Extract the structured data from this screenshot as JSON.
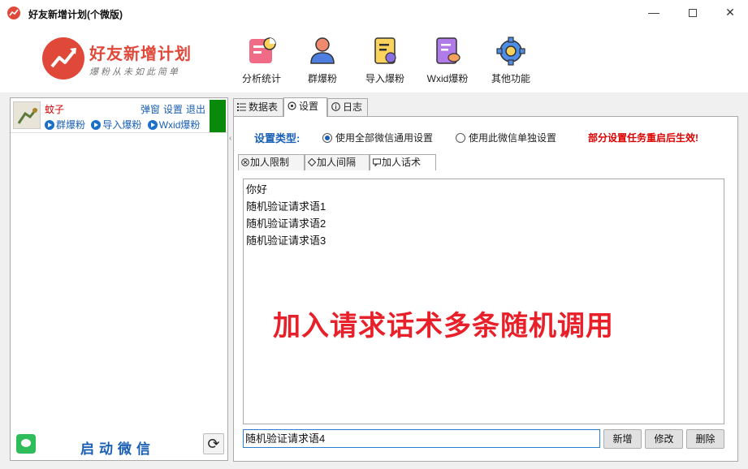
{
  "window": {
    "title": "好友新增计划(个微版)",
    "min": "—",
    "close": "✕"
  },
  "header": {
    "logo_title": "好友新增计划",
    "logo_slogan": "爆粉从未如此简单",
    "tools": [
      {
        "label": "分析统计",
        "icon": "chart-doc-icon"
      },
      {
        "label": "群爆粉",
        "icon": "user-icon"
      },
      {
        "label": "导入爆粉",
        "icon": "import-doc-icon"
      },
      {
        "label": "Wxid爆粉",
        "icon": "chat-doc-icon"
      },
      {
        "label": "其他功能",
        "icon": "gear-icon"
      }
    ]
  },
  "account": {
    "name": "蚊子",
    "actions": [
      "弹窗",
      "设置",
      "退出"
    ],
    "links": [
      "群爆粉",
      "导入爆粉",
      "Wxid爆粉"
    ]
  },
  "left_footer": {
    "start_label": "启动微信"
  },
  "main_tabs": [
    {
      "label": "数据表",
      "active": false
    },
    {
      "label": "设置",
      "active": true
    },
    {
      "label": "日志",
      "active": false
    }
  ],
  "settings": {
    "type_label": "设置类型:",
    "radio_all": "使用全部微信通用设置",
    "radio_single": "使用此微信单独设置",
    "warning": "部分设置任务重启后生效!",
    "sub_tabs": [
      {
        "label": "加人限制",
        "active": false
      },
      {
        "label": "加人间隔",
        "active": false
      },
      {
        "label": "加人话术",
        "active": true
      }
    ],
    "lines": [
      "你好",
      "随机验证请求语1",
      "随机验证请求语2",
      "随机验证请求语3"
    ],
    "overlay_caption": "加入请求话术多条随机调用",
    "input_value": "随机验证请求语4",
    "buttons": {
      "add": "新增",
      "edit": "修改",
      "delete": "删除"
    }
  },
  "colors": {
    "accent": "#1a5fb4",
    "brand": "#e0493a",
    "warning": "#dd0000",
    "status_green": "#0a8a0a"
  }
}
